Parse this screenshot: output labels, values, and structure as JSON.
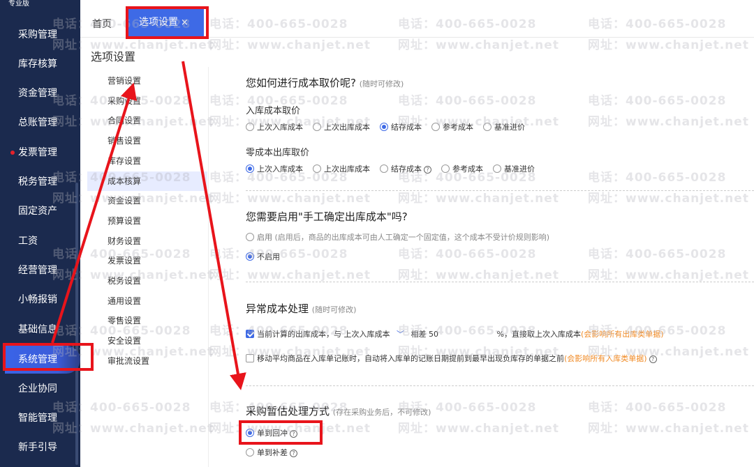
{
  "sidebar": {
    "brand": "专业版",
    "items": [
      {
        "label": "采购管理",
        "name": "sidebar-item-purchase"
      },
      {
        "label": "库存核算",
        "name": "sidebar-item-inventory-accounting"
      },
      {
        "label": "资金管理",
        "name": "sidebar-item-funds"
      },
      {
        "label": "总账管理",
        "name": "sidebar-item-general-ledger"
      },
      {
        "label": "发票管理",
        "name": "sidebar-item-invoice"
      },
      {
        "label": "税务管理",
        "name": "sidebar-item-tax"
      },
      {
        "label": "固定资产",
        "name": "sidebar-item-fixed-assets"
      },
      {
        "label": "工资",
        "name": "sidebar-item-payroll"
      },
      {
        "label": "经营管理",
        "name": "sidebar-item-operations"
      },
      {
        "label": "小畅报销",
        "name": "sidebar-item-reimbursement"
      },
      {
        "label": "基础信息",
        "name": "sidebar-item-basic-info"
      },
      {
        "label": "系统管理",
        "name": "sidebar-item-system"
      },
      {
        "label": "企业协同",
        "name": "sidebar-item-collaboration"
      },
      {
        "label": "智能管理",
        "name": "sidebar-item-smart"
      },
      {
        "label": "新手引导",
        "name": "sidebar-item-guide"
      }
    ]
  },
  "tabs": {
    "home": "首页",
    "options": "选项设置",
    "close": "×"
  },
  "page_title": "选项设置",
  "submenu": [
    "营销设置",
    "采购设置",
    "合同设置",
    "销售设置",
    "库存设置",
    "成本核算",
    "资金设置",
    "预算设置",
    "财务设置",
    "发票设置",
    "税务设置",
    "通用设置",
    "零售设置",
    "安全设置",
    "审批流设置"
  ],
  "cost": {
    "title": "您如何进行成本取价呢?",
    "title_note": "(随时可修改)",
    "inbound_label": "入库成本取价",
    "inbound_options": [
      "上次入库成本",
      "上次出库成本",
      "结存成本",
      "参考成本",
      "基准进价"
    ],
    "zero_label": "零成本出库取价",
    "zero_options": [
      "上次入库成本",
      "上次出库成本",
      "结存成本",
      "参考成本",
      "基准进价"
    ]
  },
  "manual": {
    "title": "您需要启用\"手工确定出库成本\"吗?",
    "enable": "启用",
    "enable_note": "(启用后，商品的出库成本可由人工确定一个固定值，这个成本不受计价规则影响)",
    "disable": "不启用"
  },
  "abnormal": {
    "title": "异常成本处理",
    "title_note": "(随时可修改)",
    "check1_a": "当前计算的出库成本，与",
    "check1_select": "上次入库成本",
    "check1_b": "相差",
    "check1_value": "50",
    "check1_c": "%，直接取上次入库成本",
    "check1_warn": "(会影响所有出库类单据)",
    "check2": "移动平均商品在入库单记账时，自动将入库单的记账日期提前到最早出现负库存的单据之前",
    "check2_warn": "(会影响所有入库类单据)"
  },
  "estimate": {
    "title": "采购暂估处理方式",
    "title_note": "(存在采购业务后，不可修改)",
    "opt1": "单到回冲",
    "opt2": "单到补差"
  },
  "watermark": {
    "phone": "电话：400-665-0028",
    "site": "网址：www.chanjet.net"
  },
  "colors": {
    "sidebar": "#1b2a4e",
    "accent": "#3e6ae6",
    "annotation": "#e8141b",
    "warn": "#f08a24"
  }
}
